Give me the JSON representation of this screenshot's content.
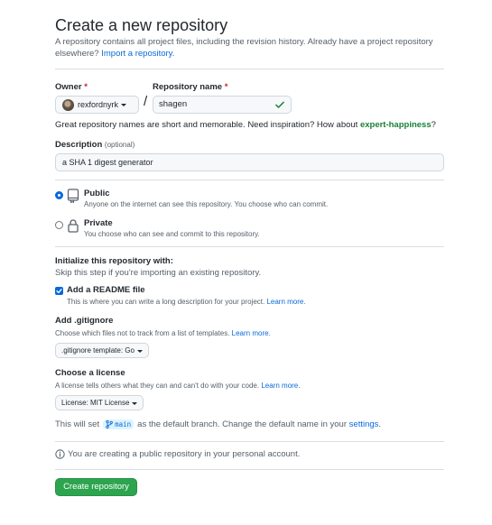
{
  "page": {
    "title": "Create a new repository",
    "subtitle": "A repository contains all project files, including the revision history. Already have a project repository elsewhere?",
    "import_link": "Import a repository."
  },
  "owner": {
    "label": "Owner",
    "required_mark": "*",
    "value": "rexfordnyrk"
  },
  "repo_name": {
    "label": "Repository name",
    "required_mark": "*",
    "value": "shagen",
    "separator": "/"
  },
  "hint": {
    "text": "Great repository names are short and memorable. Need inspiration? How about",
    "suggestion": "expert-happiness",
    "suffix": "?"
  },
  "description": {
    "label": "Description",
    "optional": "(optional)",
    "value": "a SHA 1 digest generator"
  },
  "visibility": {
    "selected": "public",
    "public_title": "Public",
    "public_desc": "Anyone on the internet can see this repository. You choose who can commit.",
    "private_title": "Private",
    "private_desc": "You choose who can see and commit to this repository."
  },
  "init": {
    "title": "Initialize this repository with:",
    "subtitle": "Skip this step if you're importing an existing repository.",
    "readme_label": "Add a README file",
    "readme_checked": true,
    "readme_desc": "This is where you can write a long description for your project.",
    "learn_more": "Learn more."
  },
  "gitignore": {
    "label": "Add .gitignore",
    "desc": "Choose which files not to track from a list of templates.",
    "learn_more": "Learn more.",
    "button": ".gitignore template: Go"
  },
  "license": {
    "label": "Choose a license",
    "desc": "A license tells others what they can and can't do with your code.",
    "learn_more": "Learn more.",
    "button": "License: MIT License"
  },
  "branch": {
    "prefix": "This will set",
    "name": "main",
    "middle": "as the default branch. Change the default name in your",
    "settings_link": "settings",
    "suffix": "."
  },
  "info": {
    "text": "You are creating a public repository in your personal account."
  },
  "submit": {
    "label": "Create repository"
  },
  "colors": {
    "link": "#0969da",
    "success": "#1a7f37",
    "primary_button": "#2da44e",
    "required": "#cf222e"
  }
}
